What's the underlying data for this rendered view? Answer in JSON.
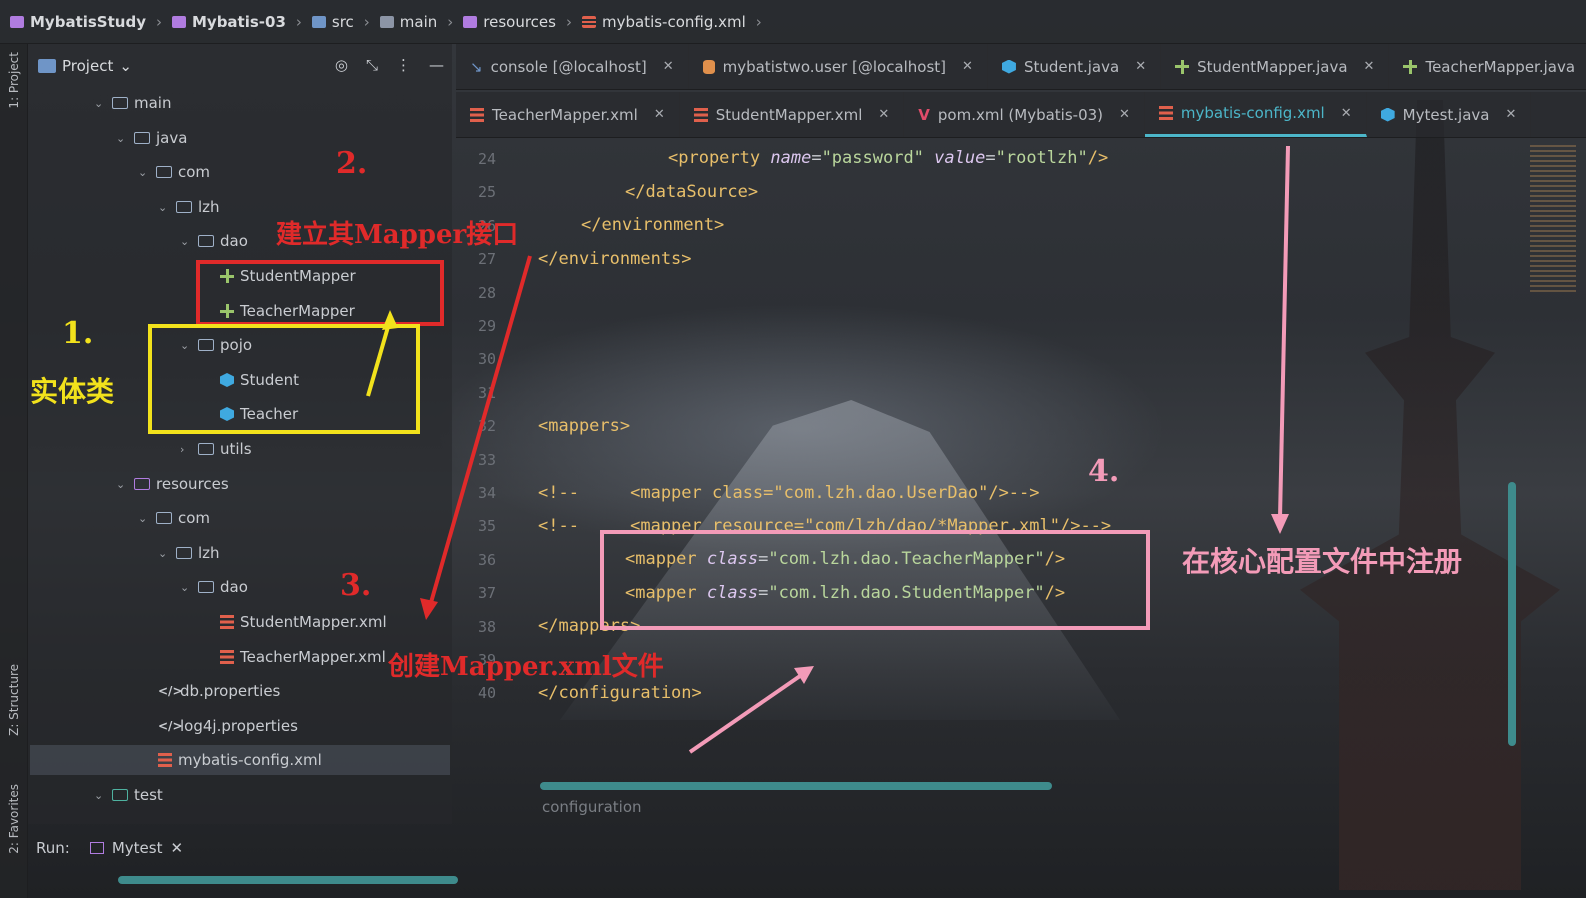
{
  "breadcrumb": {
    "project": "MybatisStudy",
    "module": "Mybatis-03",
    "src": "src",
    "main": "main",
    "resources": "resources",
    "file": "mybatis-config.xml"
  },
  "stripe": {
    "project_label": "1: Project",
    "structure_label": "Z: Structure",
    "favorites_label": "2: Favorites"
  },
  "project_panel": {
    "title": "Project",
    "tree": [
      {
        "label": "main"
      },
      {
        "label": "java"
      },
      {
        "label": "com"
      },
      {
        "label": "lzh"
      },
      {
        "label": "dao"
      },
      {
        "label": "StudentMapper"
      },
      {
        "label": "TeacherMapper"
      },
      {
        "label": "pojo"
      },
      {
        "label": "Student"
      },
      {
        "label": "Teacher"
      },
      {
        "label": "utils"
      },
      {
        "label": "resources"
      },
      {
        "label": "com"
      },
      {
        "label": "lzh"
      },
      {
        "label": "dao"
      },
      {
        "label": "StudentMapper.xml"
      },
      {
        "label": "TeacherMapper.xml"
      },
      {
        "label": "db.properties"
      },
      {
        "label": "log4j.properties"
      },
      {
        "label": "mybatis-config.xml"
      },
      {
        "label": "test"
      }
    ]
  },
  "tabs_row1": [
    {
      "label": "console [@localhost]"
    },
    {
      "label": "mybatistwo.user [@localhost]"
    },
    {
      "label": "Student.java"
    },
    {
      "label": "StudentMapper.java"
    },
    {
      "label": "TeacherMapper.java"
    }
  ],
  "tabs_row2": [
    {
      "label": "TeacherMapper.xml"
    },
    {
      "label": "StudentMapper.xml"
    },
    {
      "label": "pom.xml (Mybatis-03)"
    },
    {
      "label": "mybatis-config.xml"
    },
    {
      "label": "Mytest.java"
    }
  ],
  "editor": {
    "line_numbers": [
      "24",
      "25",
      "26",
      "27",
      "28",
      "29",
      "30",
      "31",
      "32",
      "33",
      "34",
      "35",
      "36",
      "37",
      "38",
      "39",
      "40"
    ],
    "lines": {
      "l24": {
        "open": "<property ",
        "a1": "name",
        "eq1": "=",
        "v1": "\"password\"",
        "a2": "value",
        "eq2": "=",
        "v2": "\"rootlzh\"",
        "close": "/>"
      },
      "l25": "</dataSource>",
      "l26": "</environment>",
      "l27": "</environments>",
      "l32": "<mappers>",
      "l34": "<!--     <mapper class=\"com.lzh.dao.UserDao\"/>-->",
      "l35": "<!--     <mapper resource=\"com/lzh/dao/*Mapper.xml\"/>-->",
      "l36": {
        "open": "<mapper ",
        "attr": "class",
        "eq": "=",
        "val": "\"com.lzh.dao.TeacherMapper\"",
        "close": "/>"
      },
      "l37": {
        "open": "<mapper ",
        "attr": "class",
        "eq": "=",
        "val": "\"com.lzh.dao.StudentMapper\"",
        "close": "/>"
      },
      "l38": "</mappers>",
      "l40": "</configuration>"
    },
    "bottom_crumb": "configuration"
  },
  "run": {
    "label": "Run:",
    "tab": "Mytest"
  },
  "annotations": {
    "n1": "1.",
    "n1_text": "实体类",
    "n2": "2.",
    "n2_text": "建立其Mapper接口",
    "n3": "3.",
    "n3_text": "创建Mapper.xml文件",
    "n4": "4.",
    "n4_text": "在核心配置文件中注册"
  },
  "colors": {
    "accent": "#4cb6c9",
    "annotation_red": "#e02a2a",
    "annotation_yellow": "#f2e21c",
    "annotation_pink": "#f39bb8"
  }
}
